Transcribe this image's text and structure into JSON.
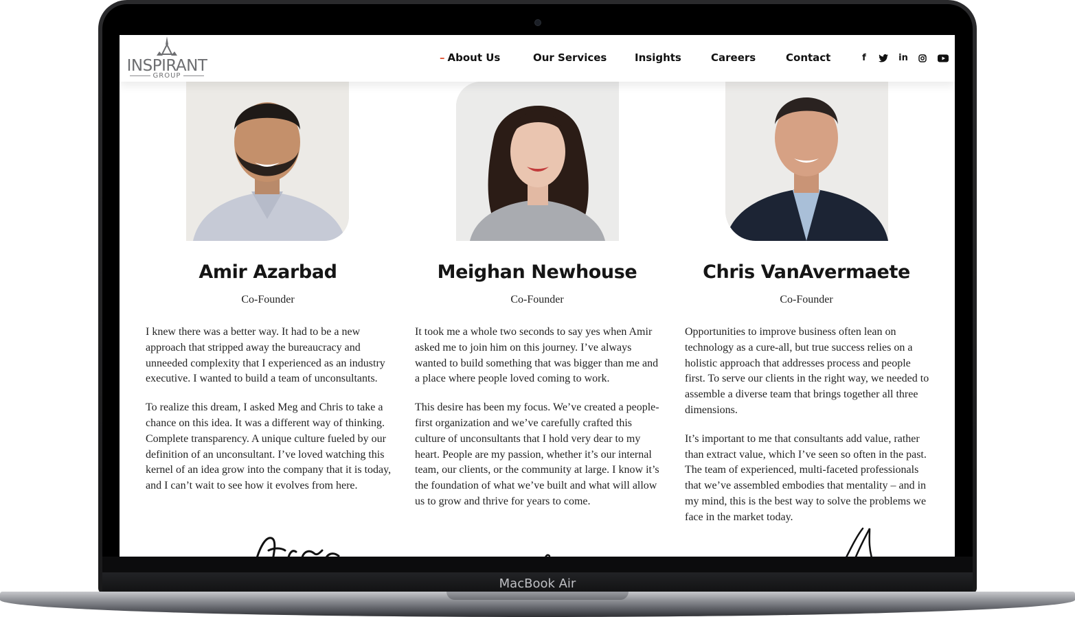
{
  "device": {
    "model_label": "MacBook Air"
  },
  "header": {
    "logo_text": "INSPIRANT",
    "logo_subtext": "GROUP",
    "nav": [
      {
        "label": "About Us",
        "active": true
      },
      {
        "label": "Our Services",
        "active": false
      },
      {
        "label": "Insights",
        "active": false
      },
      {
        "label": "Careers",
        "active": false
      },
      {
        "label": "Contact",
        "active": false
      }
    ],
    "active_marker": "–",
    "social": [
      "facebook-icon",
      "twitter-icon",
      "linkedin-icon",
      "instagram-icon",
      "youtube-icon"
    ],
    "accent_color": "#e0583a"
  },
  "founders": [
    {
      "name": "Amir Azarbad",
      "role": "Co-Founder",
      "bio": [
        "I knew there was a better way. It had to be a new approach that stripped away the bureaucracy and unneeded complexity that I experienced as an industry executive. I wanted to build a team of unconsultants.",
        "To realize this dream, I asked Meg and Chris to take a chance on this idea. It was a different way of thinking. Complete transparency. A unique culture fueled by our definition of an unconsultant. I’ve loved watching this kernel of an idea grow into the company that it is today, and I can’t wait to see how it evolves from here."
      ]
    },
    {
      "name": "Meighan Newhouse",
      "role": "Co-Founder",
      "bio": [
        "It took me a whole two seconds to say yes when Amir asked me to join him on this journey. I’ve always wanted to build something that was bigger than me and a place where people loved coming to work.",
        "This desire has been my focus. We’ve created a people-first organization and we’ve carefully crafted this culture of unconsultants that I hold very dear to my heart. People are my passion, whether it’s our internal team, our clients, or the community at large. I know it’s the foundation of what we’ve built and what will allow us to grow and thrive for years to come."
      ]
    },
    {
      "name": "Chris VanAvermaete",
      "role": "Co-Founder",
      "bio": [
        "Opportunities to improve business often lean on technology as a cure-all, but true success relies on a holistic approach that addresses process and people first. To serve our clients in the right way, we needed to assemble a diverse team that brings together all three dimensions.",
        "It’s important to me that consultants add value, rather than extract value, which I’ve seen so often in the past. The team of experienced, multi-faceted professionals that we’ve assembled embodies that mentality – and in my mind, this is the best way to solve the problems we face in the market today."
      ]
    }
  ]
}
